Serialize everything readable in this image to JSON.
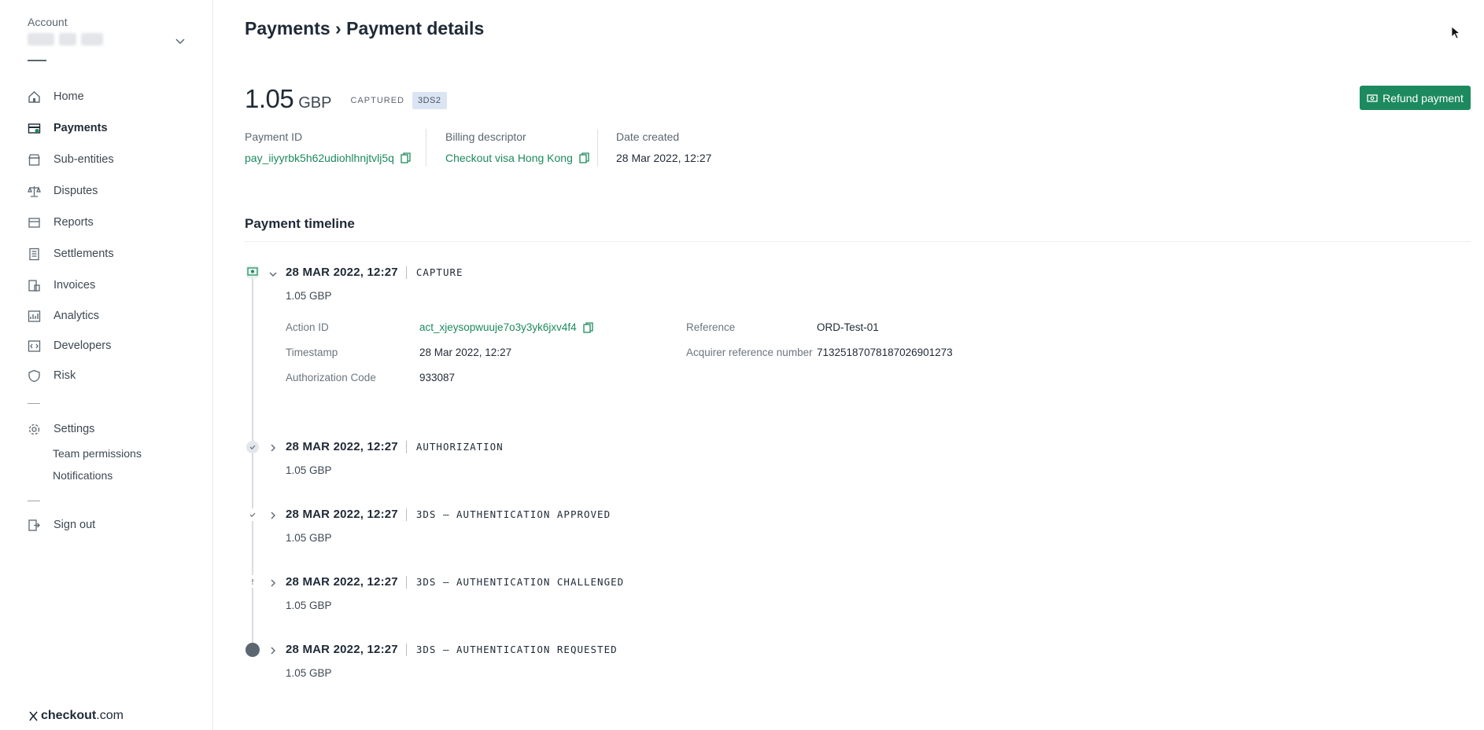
{
  "sidebar": {
    "account_label": "Account",
    "nav": [
      {
        "label": "Home",
        "icon": "home-icon"
      },
      {
        "label": "Payments",
        "icon": "payments-icon",
        "active": true
      },
      {
        "label": "Sub-entities",
        "icon": "store-icon"
      },
      {
        "label": "Disputes",
        "icon": "scale-icon"
      },
      {
        "label": "Reports",
        "icon": "report-icon"
      },
      {
        "label": "Settlements",
        "icon": "document-icon"
      },
      {
        "label": "Invoices",
        "icon": "invoice-icon"
      },
      {
        "label": "Analytics",
        "icon": "analytics-icon"
      },
      {
        "label": "Developers",
        "icon": "code-icon"
      },
      {
        "label": "Risk",
        "icon": "shield-icon"
      }
    ],
    "settings": {
      "label": "Settings",
      "icon": "gear-icon"
    },
    "settings_sub": [
      "Team permissions",
      "Notifications"
    ],
    "sign_out": {
      "label": "Sign out",
      "icon": "sign-out-icon"
    },
    "brand": {
      "mark": "checkout",
      "suffix": ".com"
    }
  },
  "header": {
    "breadcrumb": "Payments › Payment details"
  },
  "payment": {
    "amount": "1.05",
    "currency": "GBP",
    "status": "CAPTURED",
    "badge": "3DS2",
    "refund_label": "Refund payment",
    "payment_id_label": "Payment ID",
    "payment_id": "pay_iiyyrbk5h62udiohlhnjtvlj5q",
    "billing_descriptor_label": "Billing descriptor",
    "billing_descriptor": "Checkout visa Hong Kong",
    "date_created_label": "Date created",
    "date_created": "28 Mar 2022, 12:27"
  },
  "timeline": {
    "title": "Payment timeline",
    "events": [
      {
        "date": "28 MAR 2022, 12:27",
        "type": "CAPTURE",
        "amount": "1.05 GBP",
        "expanded": true,
        "details": {
          "action_id_label": "Action ID",
          "action_id": "act_xjeysopwuuje7o3y3yk6jxv4f4",
          "timestamp_label": "Timestamp",
          "timestamp": "28 Mar 2022, 12:27",
          "auth_code_label": "Authorization Code",
          "auth_code": "933087",
          "reference_label": "Reference",
          "reference": "ORD-Test-01",
          "arn_label": "Acquirer reference number",
          "arn": "71325187078187026901273"
        }
      },
      {
        "date": "28 MAR 2022, 12:27",
        "type": "AUTHORIZATION",
        "amount": "1.05 GBP"
      },
      {
        "date": "28 MAR 2022, 12:27",
        "type": "3DS – AUTHENTICATION APPROVED",
        "amount": "1.05 GBP"
      },
      {
        "date": "28 MAR 2022, 12:27",
        "type": "3DS – AUTHENTICATION CHALLENGED",
        "amount": "1.05 GBP"
      },
      {
        "date": "28 MAR 2022, 12:27",
        "type": "3DS – AUTHENTICATION REQUESTED",
        "amount": "1.05 GBP"
      }
    ]
  },
  "colors": {
    "accent": "#1c8a5e",
    "badge_bg": "#dbe4f3",
    "text": "#1f2a37"
  }
}
